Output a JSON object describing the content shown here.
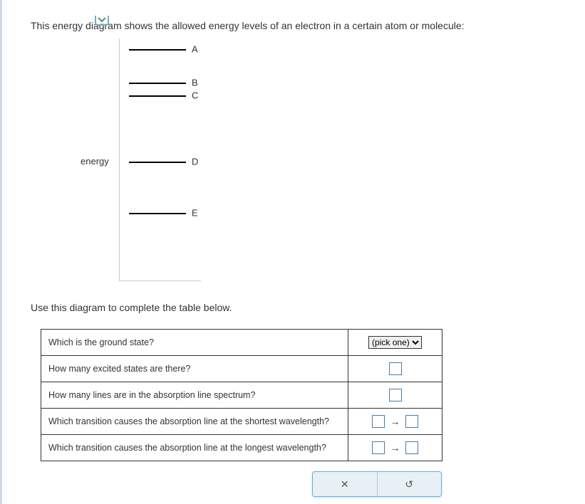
{
  "intro": "This energy diagram shows the allowed energy levels of an electron in a certain atom or molecule:",
  "diagram": {
    "axisLabel": "energy",
    "levels": {
      "a": "A",
      "b": "B",
      "c": "C",
      "d": "D",
      "e": "E"
    }
  },
  "subIntro": "Use this diagram to complete the table below.",
  "table": {
    "q1": "Which is the ground state?",
    "q2": "How many excited states are there?",
    "q3": "How many lines are in the absorption line spectrum?",
    "q4": "Which transition causes the absorption line at the shortest wavelength?",
    "q5": "Which transition causes the absorption line at the longest wavelength?",
    "pickOne": "(pick one)",
    "arrow": "→"
  },
  "buttons": {
    "close": "✕",
    "reset": "↺"
  },
  "chart_data": {
    "type": "other",
    "description": "Energy level diagram",
    "axis_label": "energy",
    "levels": [
      {
        "label": "A",
        "position": 15
      },
      {
        "label": "B",
        "position": 62
      },
      {
        "label": "C",
        "position": 80
      },
      {
        "label": "D",
        "position": 173
      },
      {
        "label": "E",
        "position": 245
      }
    ],
    "axis_height": 340
  }
}
